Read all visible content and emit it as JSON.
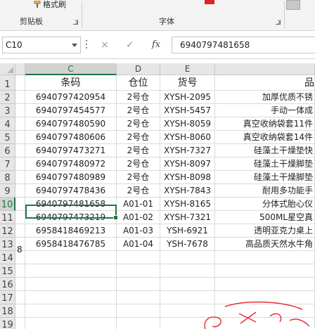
{
  "ribbon": {
    "format_painter_label": "格式刷",
    "clipboard_group": "剪贴板",
    "font_group": "字体"
  },
  "formula_bar": {
    "name_box": "C10",
    "cancel_icon": "×",
    "enter_icon": "✓",
    "fx_label": "fx",
    "content": "6940797481658"
  },
  "columns": [
    "C",
    "D",
    "E"
  ],
  "row_numbers": [
    "1",
    "2",
    "3",
    "4",
    "5",
    "6",
    "7",
    "8",
    "9",
    "10",
    "11",
    "12",
    "13",
    "14",
    "15",
    "16",
    "17",
    "18",
    "19"
  ],
  "selected_cell": "C10",
  "header_row": {
    "barcode": "条码",
    "location": "仓位",
    "item_no": "货号",
    "name": "品"
  },
  "rows": [
    {
      "barcode": "6940797420954",
      "location": "2号仓",
      "item_no": "XYSH-2095",
      "name": "加厚优质不锈"
    },
    {
      "barcode": "6940797454577",
      "location": "2号仓",
      "item_no": "XYSH-5457",
      "name": "手动一体成"
    },
    {
      "barcode": "6940797480590",
      "location": "2号仓",
      "item_no": "XYSH-8059",
      "name": "真空收纳袋套11件"
    },
    {
      "barcode": "6940797480606",
      "location": "2号仓",
      "item_no": "XYSH-8060",
      "name": "真空收纳袋套14件"
    },
    {
      "barcode": "6940797473271",
      "location": "2号仓",
      "item_no": "XYSH-7327",
      "name": "硅藻土干燥垫快"
    },
    {
      "barcode": "6940797480972",
      "location": "2号仓",
      "item_no": "XYSH-8097",
      "name": "硅藻土干燥脚垫"
    },
    {
      "barcode": "6940797480989",
      "location": "2号仓",
      "item_no": "XYSH-8098",
      "name": "硅藻土干燥脚垫"
    },
    {
      "barcode": "6940797478436",
      "location": "2号仓",
      "item_no": "XYSH-7843",
      "name": "耐用多功能手"
    },
    {
      "barcode": "6940797481658",
      "location": "A01-01",
      "item_no": "XYSH-8165",
      "name": "分体式胎心仪"
    },
    {
      "barcode": "6940797473219",
      "location": "A01-02",
      "item_no": "XYSH-7321",
      "name": "500ML星空真"
    },
    {
      "barcode": "6958418469213",
      "location": "A01-03",
      "item_no": "YSH-6921",
      "name": "透明亚克力桌上"
    },
    {
      "barcode": "6958418476785",
      "location": "A01-04",
      "item_no": "YSH-7678",
      "name": "高品质天然水牛角"
    }
  ],
  "stray_text": "8",
  "colors": {
    "accent_green": "#217346",
    "scribble_red": "#e8313a"
  }
}
